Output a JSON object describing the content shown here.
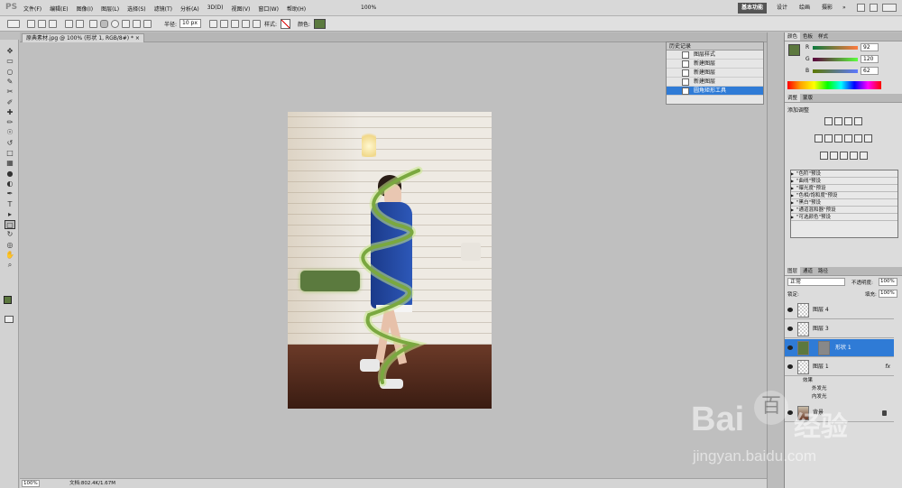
{
  "app": {
    "logo": "PS",
    "menus": [
      "文件(F)",
      "编辑(E)",
      "图像(I)",
      "图层(L)",
      "选择(S)",
      "滤镜(T)",
      "分析(A)",
      "3D(D)",
      "视图(V)",
      "窗口(W)",
      "帮助(H)"
    ],
    "zoom": "100%",
    "workspaces": [
      "基本功能",
      "设计",
      "绘画",
      "摄影"
    ],
    "workspace_active": "基本功能",
    "more": "»"
  },
  "options": {
    "radius_label": "半径:",
    "radius_value": "10 px",
    "style_label": "样式:",
    "color_label": "颜色:",
    "color": "#5b7a3e"
  },
  "document": {
    "tab_title": "原典素材.jpg @ 100% (形状 1, RGB/8#) *",
    "close": "×",
    "zoom": "100%",
    "doc_size": "文档:802.4K/1.67M"
  },
  "history": {
    "title": "历史记录",
    "items": [
      "图层样式",
      "新建图层",
      "新建图层",
      "新建图层",
      "圆角矩形工具"
    ],
    "selected_index": 4
  },
  "color_panel": {
    "tabs": [
      "颜色",
      "色板",
      "样式"
    ],
    "r_label": "R",
    "r": "92",
    "g_label": "G",
    "g": "120",
    "b_label": "B",
    "b": "62",
    "swatch": "#5c783e"
  },
  "adjust_panel": {
    "tabs": [
      "调整",
      "蒙版"
    ],
    "title": "添加调整",
    "presets": [
      "\"色阶\"预设",
      "\"曲线\"预设",
      "\"曝光度\"预设",
      "\"色相/饱和度\"预设",
      "\"黑白\"预设",
      "\"通道混和器\"预设",
      "\"可选颜色\"预设"
    ]
  },
  "layers_panel": {
    "tabs": [
      "图层",
      "通道",
      "路径"
    ],
    "blend_mode": "正常",
    "opacity_label": "不透明度:",
    "opacity": "100%",
    "lock_label": "锁定:",
    "fill_label": "填充:",
    "fill": "100%",
    "layers": [
      {
        "name": "图层 4"
      },
      {
        "name": "图层 3"
      },
      {
        "name": "形状 1",
        "selected": true
      },
      {
        "name": "图层 1",
        "fx": "fx"
      },
      {
        "name": "背景",
        "lock": true
      }
    ],
    "effects_label": "效果",
    "effects": [
      "外发光",
      "内发光"
    ]
  },
  "watermark": {
    "brand": "Bai",
    "brand2": "百",
    "site": "jingyan.baidu.com",
    "cn": "经验"
  }
}
